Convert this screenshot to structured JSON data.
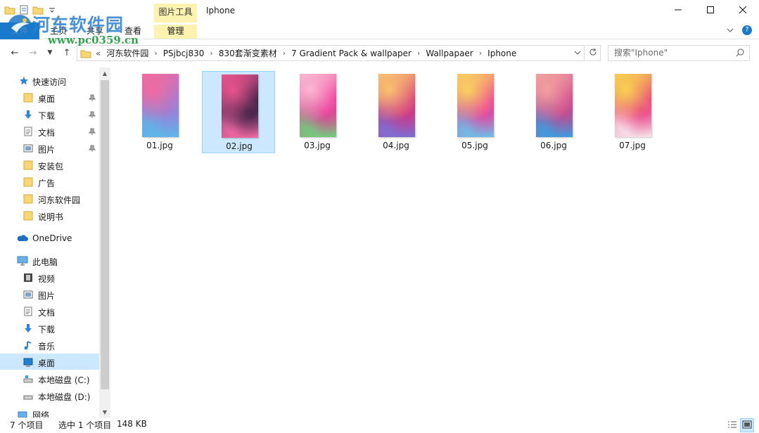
{
  "window": {
    "title": "Iphone",
    "contextual_tab_group": "图片工具",
    "controls": {
      "minimize": "minimize-icon",
      "maximize": "maximize-icon",
      "close": "close-icon"
    }
  },
  "ribbon": {
    "tabs": [
      {
        "label": "文件"
      },
      {
        "label": "主页"
      },
      {
        "label": "共享"
      },
      {
        "label": "查看"
      },
      {
        "label": "管理"
      }
    ],
    "help": "?"
  },
  "address": {
    "overflow": "«",
    "crumbs": [
      "河东软件园",
      "PSjbcj830",
      "830套渐变素材",
      "7 Gradient Pack & wallpaper",
      "Wallpapaer",
      "Iphone"
    ]
  },
  "search": {
    "placeholder": "搜索\"Iphone\""
  },
  "nav": {
    "quick_access": "快速访问",
    "quick_items": [
      {
        "label": "桌面",
        "pinned": true
      },
      {
        "label": "下载",
        "pinned": true
      },
      {
        "label": "文档",
        "pinned": true
      },
      {
        "label": "图片",
        "pinned": true
      },
      {
        "label": "安装包"
      },
      {
        "label": "广告"
      },
      {
        "label": "河东软件园"
      },
      {
        "label": "说明书"
      }
    ],
    "onedrive": "OneDrive",
    "this_pc": "此电脑",
    "pc_items": [
      {
        "label": "视频"
      },
      {
        "label": "图片"
      },
      {
        "label": "文档"
      },
      {
        "label": "下载"
      },
      {
        "label": "音乐"
      },
      {
        "label": "桌面",
        "selected": true
      },
      {
        "label": "本地磁盘 (C:)"
      },
      {
        "label": "本地磁盘 (D:)"
      },
      {
        "label": "网络"
      }
    ]
  },
  "files": [
    {
      "name": "01.jpg",
      "colors": [
        "#f06aa0",
        "#9a7fd8",
        "#5ab8e8"
      ]
    },
    {
      "name": "02.jpg",
      "colors": [
        "#e8548e",
        "#2a1c3e",
        "#f46aa4"
      ],
      "selected": true
    },
    {
      "name": "03.jpg",
      "colors": [
        "#f9b6d0",
        "#f0309a",
        "#6fcf7c"
      ]
    },
    {
      "name": "04.jpg",
      "colors": [
        "#f8c070",
        "#d6337e",
        "#7a6fd4"
      ]
    },
    {
      "name": "05.jpg",
      "colors": [
        "#f8d060",
        "#f0389a",
        "#6ac0e8"
      ]
    },
    {
      "name": "06.jpg",
      "colors": [
        "#f0a0a0",
        "#d0408a",
        "#3a9ee0"
      ]
    },
    {
      "name": "07.jpg",
      "colors": [
        "#f8d050",
        "#e83a80",
        "#f6e4ea"
      ]
    }
  ],
  "status": {
    "count": "7 个项目",
    "selected": "选中 1 个项目",
    "size": "148 KB"
  },
  "watermark": {
    "title": "河东软件园",
    "url": "www.pc0359.cn"
  }
}
